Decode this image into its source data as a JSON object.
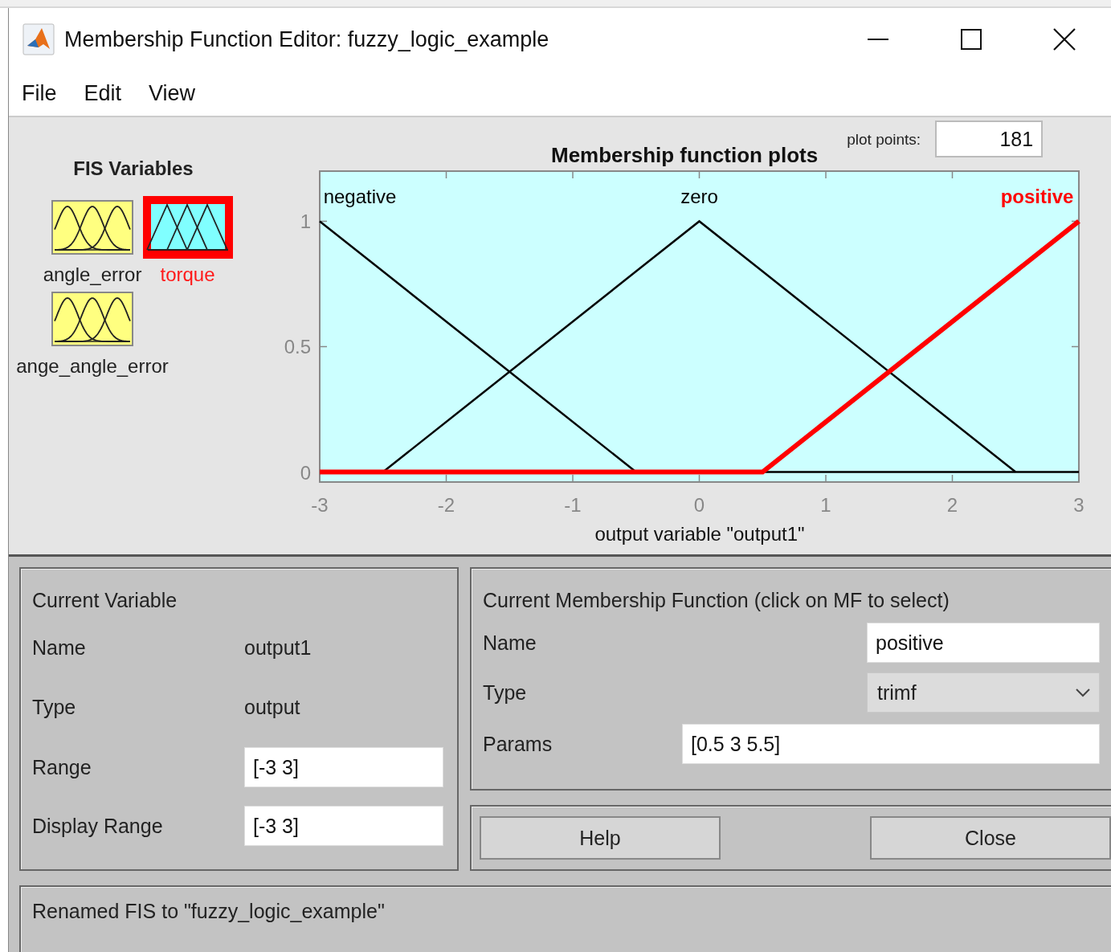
{
  "window": {
    "title": "Membership Function Editor: fuzzy_logic_example"
  },
  "menu": [
    {
      "label": "File"
    },
    {
      "label": "Edit"
    },
    {
      "label": "View"
    }
  ],
  "fis_variables": {
    "title": "FIS Variables",
    "items": [
      {
        "name": "angle_error",
        "kind": "input",
        "selected": false
      },
      {
        "name": "torque",
        "kind": "output",
        "selected": true
      },
      {
        "name": "ange_angle_error",
        "kind": "input",
        "selected": false
      }
    ]
  },
  "plot": {
    "title": "Membership function plots",
    "plot_points_label": "plot points:",
    "plot_points": "181",
    "chart_data": {
      "type": "line",
      "xlabel": "output variable \"output1\"",
      "x": [
        -3,
        -2.5,
        -0.5,
        0,
        0.5,
        2.5,
        3
      ],
      "series": [
        {
          "name": "negative",
          "color": "#000000",
          "values": [
            1,
            0.8,
            0,
            null,
            null,
            null,
            null
          ]
        },
        {
          "name": "zero",
          "color": "#000000",
          "values": [
            null,
            0,
            0.8,
            1,
            0.8,
            0,
            null
          ]
        },
        {
          "name": "positive",
          "color": "#ff0000",
          "values": [
            0,
            0,
            0,
            0,
            0,
            0.8,
            1
          ]
        }
      ],
      "xlim": [
        -3,
        3
      ],
      "ylim": [
        -0.04,
        1.2
      ],
      "xticks": [
        -3,
        -2,
        -1,
        0,
        1,
        2,
        3
      ],
      "yticks": [
        0,
        0.5,
        1
      ]
    }
  },
  "current_variable": {
    "title": "Current Variable",
    "name_label": "Name",
    "name": "output1",
    "type_label": "Type",
    "type": "output",
    "range_label": "Range",
    "range": "[-3 3]",
    "display_range_label": "Display Range",
    "display_range": "[-3 3]"
  },
  "current_mf": {
    "title": "Current Membership Function (click on MF to select)",
    "name_label": "Name",
    "name": "positive",
    "type_label": "Type",
    "type": "trimf",
    "params_label": "Params",
    "params": "[0.5 3 5.5]"
  },
  "buttons": [
    "Help",
    "Close"
  ],
  "status": "Renamed FIS to \"fuzzy_logic_example\""
}
